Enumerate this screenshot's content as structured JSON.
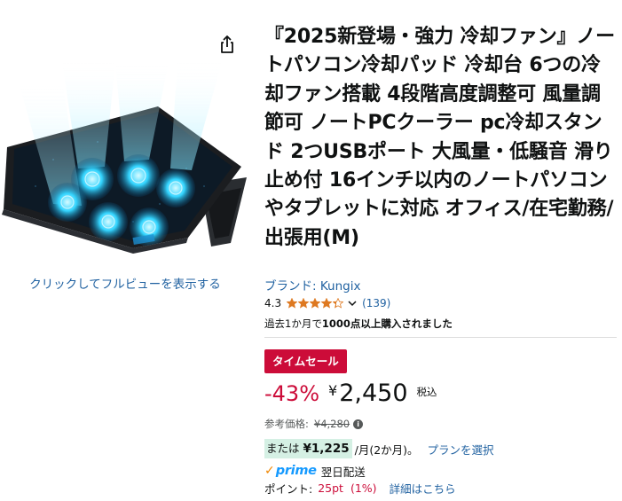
{
  "product": {
    "title": "『2025新登場・強力 冷却ファン』ノートパソコン冷却パッド 冷却台 6つの冷却ファン搭載 4段階高度調整可 風量調節可 ノートPCクーラー pc冷却スタンド 2つUSBポート 大風量・低騒音 滑り止め付 16インチ以内のノートパソコンやタブレットに対応 オフィス/在宅勤務/出張用(M)",
    "brand_link": "ブランド: Kungix",
    "rating_value": "4.3",
    "rating_stars": 4.3,
    "review_count": "(139)",
    "bought_prefix": "過去1か月で",
    "bought_bold": "1000点以上購入されました"
  },
  "image": {
    "fullview_label": "クリックしてフルビューを表示する",
    "share_icon": "share-icon"
  },
  "pricing": {
    "deal_badge": "タイムセール",
    "discount": "-43%",
    "currency": "¥",
    "price": "2,450",
    "tax_label": "税込",
    "list_label": "参考価格:",
    "list_price": "¥4,280",
    "installment_prefix": "または",
    "installment_amount": "¥1,225",
    "installment_term": "/月(2か月)。",
    "plan_link": "プランを選択"
  },
  "delivery": {
    "prime_check": "✓",
    "prime_label": "prime",
    "delivery_text": "翌日配送"
  },
  "points": {
    "label": "ポイント:",
    "value": "25pt",
    "percent": "(1%)",
    "detail_link": "詳細はこちら"
  },
  "colors": {
    "link": "#2162a1",
    "deal_red": "#cc0c39",
    "star": "#de7921",
    "installment_bg": "#d5f0e4",
    "prime_blue": "#1399ff"
  }
}
